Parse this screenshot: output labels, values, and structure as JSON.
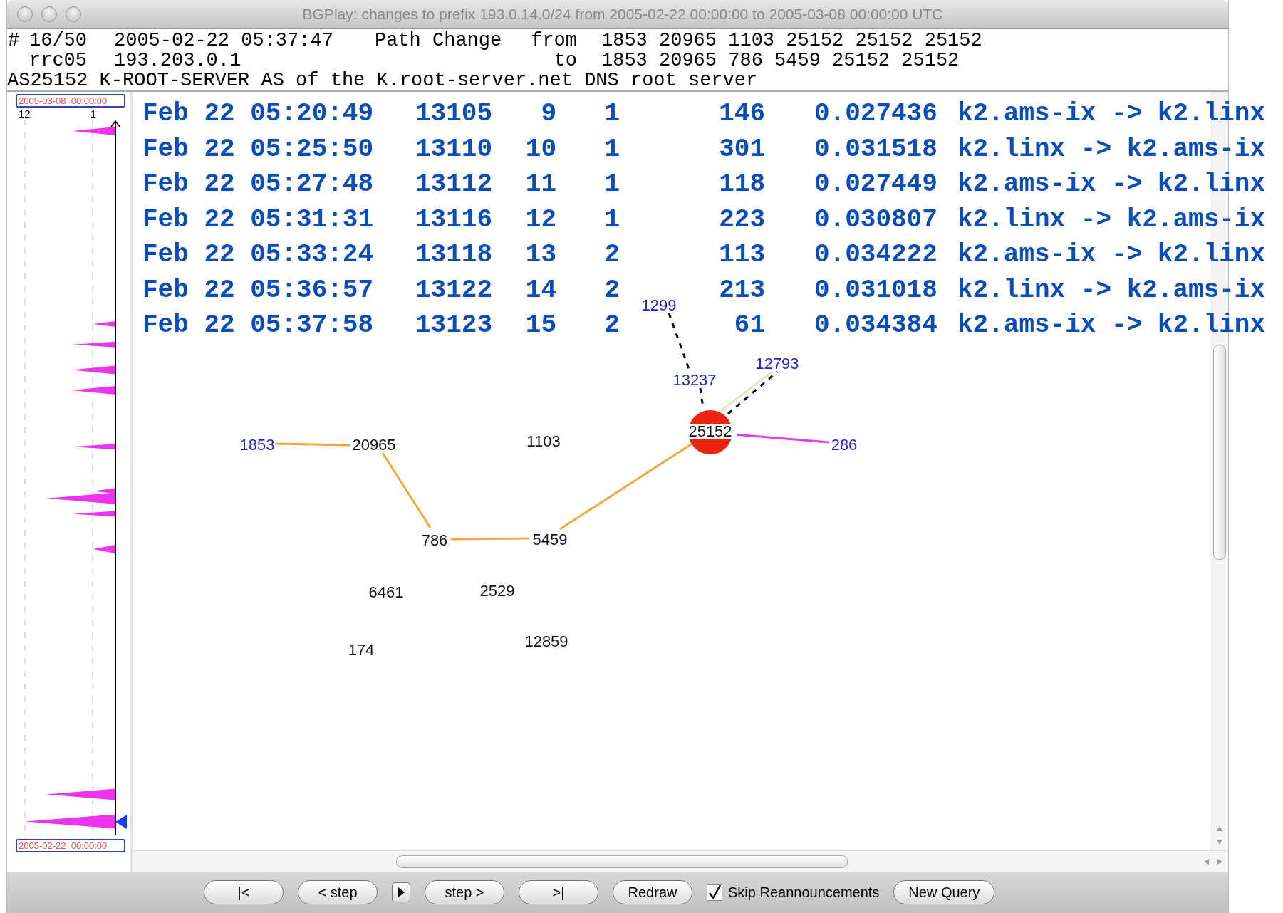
{
  "window": {
    "title": "BGPlay: changes to prefix 193.0.14.0/24 from 2005-02-22 00:00:00 to 2005-03-08 00:00:00 UTC"
  },
  "header": {
    "mark": "#",
    "index": "16/50",
    "timestamp": "2005-02-22 05:37:47",
    "event": "Path Change",
    "from_label": "from",
    "from_path": "1853 20965 1103 25152 25152 25152",
    "collector": "rrc05",
    "peer": "193.203.0.1",
    "to_label": "to",
    "to_path": "1853 20965 786 5459 25152 25152",
    "as_description": "AS25152 K-ROOT-SERVER AS of the K.root-server.net DNS root server"
  },
  "timeline": {
    "end_label": "2005-03-08  00:00:00",
    "start_label": "2005-02-22  00:00:00",
    "axis_labels": [
      "12",
      "1"
    ]
  },
  "events": [
    {
      "time": "Feb 22 05:20:49",
      "id": "13105",
      "column_3": "9",
      "column_4": "1",
      "column_5": "146",
      "column_6": "0.027436",
      "route": "k2.ams-ix -> k2.linx"
    },
    {
      "time": "Feb 22 05:25:50",
      "id": "13110",
      "column_3": "10",
      "column_4": "1",
      "column_5": "301",
      "column_6": "0.031518",
      "route": "k2.linx -> k2.ams-ix"
    },
    {
      "time": "Feb 22 05:27:48",
      "id": "13112",
      "column_3": "11",
      "column_4": "1",
      "column_5": "118",
      "column_6": "0.027449",
      "route": "k2.ams-ix -> k2.linx"
    },
    {
      "time": "Feb 22 05:31:31",
      "id": "13116",
      "column_3": "12",
      "column_4": "1",
      "column_5": "223",
      "column_6": "0.030807",
      "route": "k2.linx -> k2.ams-ix"
    },
    {
      "time": "Feb 22 05:33:24",
      "id": "13118",
      "column_3": "13",
      "column_4": "2",
      "column_5": "113",
      "column_6": "0.034222",
      "route": "k2.ams-ix -> k2.linx"
    },
    {
      "time": "Feb 22 05:36:57",
      "id": "13122",
      "column_3": "14",
      "column_4": "2",
      "column_5": "213",
      "column_6": "0.031018",
      "route": "k2.linx -> k2.ams-ix"
    },
    {
      "time": "Feb 22 05:37:58",
      "id": "13123",
      "column_3": "15",
      "column_4": "2",
      "column_5": "61",
      "column_6": "0.034384",
      "route": "k2.ams-ix -> k2.linx"
    }
  ],
  "graph": {
    "nodes": [
      {
        "label": "1853",
        "color": "#2424c8",
        "kind": "plain"
      },
      {
        "label": "20965",
        "color": "#111111",
        "kind": "plain"
      },
      {
        "label": "1103",
        "color": "#111111",
        "kind": "plain"
      },
      {
        "label": "25152",
        "color": "#111111",
        "kind": "origin"
      },
      {
        "label": "286",
        "color": "#2424c8",
        "kind": "plain"
      },
      {
        "label": "1299",
        "color": "#2424c8",
        "kind": "plain"
      },
      {
        "label": "13237",
        "color": "#2424c8",
        "kind": "plain"
      },
      {
        "label": "12793",
        "color": "#2424c8",
        "kind": "plain"
      },
      {
        "label": "786",
        "color": "#111111",
        "kind": "plain"
      },
      {
        "label": "5459",
        "color": "#111111",
        "kind": "plain"
      },
      {
        "label": "6461",
        "color": "#111111",
        "kind": "plain"
      },
      {
        "label": "2529",
        "color": "#111111",
        "kind": "plain"
      },
      {
        "label": "12859",
        "color": "#111111",
        "kind": "plain"
      },
      {
        "label": "174",
        "color": "#111111",
        "kind": "plain"
      }
    ],
    "edges": [
      {
        "kind": "solid",
        "color": "#f0a83a"
      },
      {
        "kind": "solid",
        "color": "#f0a83a"
      },
      {
        "kind": "solid",
        "color": "#f0a83a"
      },
      {
        "kind": "solid",
        "color": "#f0a83a"
      },
      {
        "kind": "solid",
        "color": "#e040e0"
      },
      {
        "kind": "solid",
        "color": "#dfe8b8"
      },
      {
        "kind": "dashed",
        "color": "#111111"
      },
      {
        "kind": "dashed",
        "color": "#111111"
      },
      {
        "kind": "dashed",
        "color": "#111111"
      }
    ]
  },
  "controls": {
    "buttons": [
      "|<",
      "< step",
      "step >",
      ">|",
      "Redraw"
    ],
    "skip": {
      "label": "Skip Reannouncements",
      "checked": true
    },
    "new_query": "New Query"
  }
}
